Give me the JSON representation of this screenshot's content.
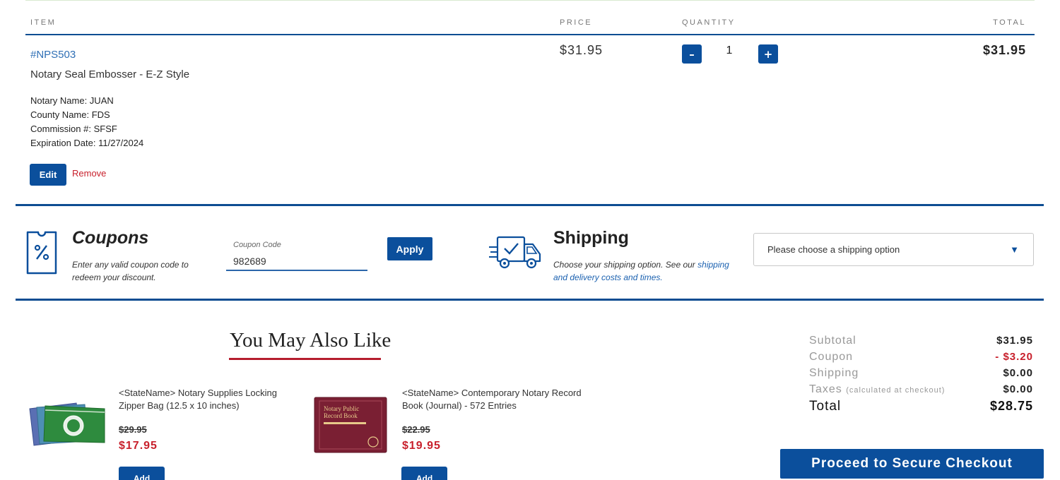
{
  "cart": {
    "headers": {
      "item": "ITEM",
      "price": "PRICE",
      "quantity": "QUANTITY",
      "total": "TOTAL"
    },
    "item": {
      "sku": "#NPS503",
      "title": "Notary Seal Embosser - E-Z Style",
      "specs": [
        "Notary Name: JUAN",
        "County Name: FDS",
        "Commission #: SFSF",
        "Expiration Date: 11/27/2024"
      ],
      "edit_label": "Edit",
      "remove_label": "Remove",
      "price": "$31.95",
      "decrement_label": "–",
      "quantity": "1",
      "increment_label": "+",
      "line_total": "$31.95"
    }
  },
  "coupons": {
    "title": "Coupons",
    "description": "Enter any valid coupon code to redeem your discount.",
    "field_label": "Coupon Code",
    "code_value": "982689",
    "apply_label": "Apply",
    "icon": "coupon-ticket-icon"
  },
  "shipping": {
    "title": "Shipping",
    "description_prefix": "Choose your shipping option. See our ",
    "link_text": "shipping and delivery costs and times.",
    "select_value": "Please choose a shipping option",
    "select_arrow": "▼",
    "icon": "delivery-truck-icon"
  },
  "recommendations": {
    "title": "You May Also Like",
    "items": [
      {
        "name": "<StateName> Notary Supplies Locking Zipper Bag (12.5 x 10 inches)",
        "old_price": "$29.95",
        "price": "$17.95",
        "add_label": "Add"
      },
      {
        "name": "<StateName> Contemporary Notary Record Book (Journal) - 572 Entries",
        "old_price": "$22.95",
        "price": "$19.95",
        "add_label": "Add",
        "cover_text_line1": "Notary Public",
        "cover_text_line2": "Record Book"
      }
    ]
  },
  "summary": {
    "subtotal_label": "Subtotal",
    "subtotal": "$31.95",
    "coupon_label": "Coupon",
    "coupon": "- $3.20",
    "shipping_label": "Shipping",
    "shipping": "$0.00",
    "taxes_label": "Taxes",
    "taxes_note": "(calculated at checkout)",
    "taxes": "$0.00",
    "total_label": "Total",
    "total": "$28.75"
  },
  "checkout": {
    "label": "Proceed to Secure Checkout"
  },
  "colors": {
    "primary": "#0b4f9c",
    "accent_red": "#c8202c",
    "link": "#2f6fb5"
  }
}
